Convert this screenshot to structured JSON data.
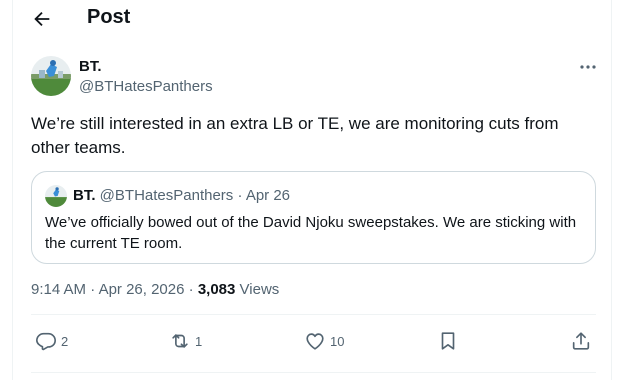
{
  "header": {
    "title": "Post"
  },
  "post": {
    "author_name": "BT.",
    "author_handle": "@BTHatesPanthers",
    "text": "We’re still interested in an extra LB or TE, we are monitoring cuts from other teams.",
    "quote": {
      "author_name": "BT.",
      "author_handle": "@BTHatesPanthers",
      "separator": "·",
      "date": "Apr 26",
      "text": "We’ve officially bowed out of the David Njoku sweepstakes. We are sticking with the current TE room."
    },
    "time": "9:14 AM",
    "date": "Apr 26, 2026",
    "views_count": "3,083",
    "views_label": "Views",
    "sep": "·"
  },
  "actions": {
    "replies": "2",
    "reposts": "1",
    "likes": "10"
  },
  "colors": {
    "text": "#0f1419",
    "secondary": "#536471",
    "border": "#cfd9de"
  }
}
